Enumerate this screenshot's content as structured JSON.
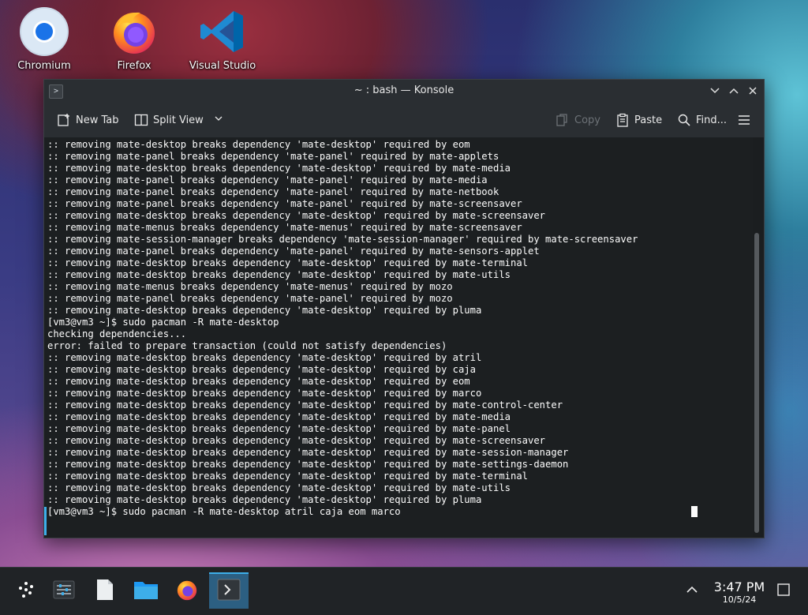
{
  "desktop": {
    "icons": [
      {
        "label": "Chromium",
        "icon": "chromium-icon"
      },
      {
        "label": "Firefox",
        "icon": "firefox-icon"
      },
      {
        "label": "Visual Studio",
        "icon": "vscode-icon"
      }
    ]
  },
  "window": {
    "title": "~ : bash — Konsole",
    "controls": {
      "minimize": "minimize-icon",
      "maximize": "maximize-icon",
      "close": "close-icon"
    }
  },
  "toolbar": {
    "new_tab": "New Tab",
    "split_view": "Split View",
    "copy": "Copy",
    "paste": "Paste",
    "find": "Find...",
    "menu": "hamburger-menu-icon"
  },
  "terminal": {
    "lines": [
      ":: removing mate-desktop breaks dependency 'mate-desktop' required by eom",
      ":: removing mate-panel breaks dependency 'mate-panel' required by mate-applets",
      ":: removing mate-desktop breaks dependency 'mate-desktop' required by mate-media",
      ":: removing mate-panel breaks dependency 'mate-panel' required by mate-media",
      ":: removing mate-panel breaks dependency 'mate-panel' required by mate-netbook",
      ":: removing mate-panel breaks dependency 'mate-panel' required by mate-screensaver",
      ":: removing mate-desktop breaks dependency 'mate-desktop' required by mate-screensaver",
      ":: removing mate-menus breaks dependency 'mate-menus' required by mate-screensaver",
      ":: removing mate-session-manager breaks dependency 'mate-session-manager' required by mate-screensaver",
      ":: removing mate-panel breaks dependency 'mate-panel' required by mate-sensors-applet",
      ":: removing mate-desktop breaks dependency 'mate-desktop' required by mate-terminal",
      ":: removing mate-desktop breaks dependency 'mate-desktop' required by mate-utils",
      ":: removing mate-menus breaks dependency 'mate-menus' required by mozo",
      ":: removing mate-panel breaks dependency 'mate-panel' required by mozo",
      ":: removing mate-desktop breaks dependency 'mate-desktop' required by pluma",
      "[vm3@vm3 ~]$ sudo pacman -R mate-desktop",
      "checking dependencies...",
      "error: failed to prepare transaction (could not satisfy dependencies)",
      ":: removing mate-desktop breaks dependency 'mate-desktop' required by atril",
      ":: removing mate-desktop breaks dependency 'mate-desktop' required by caja",
      ":: removing mate-desktop breaks dependency 'mate-desktop' required by eom",
      ":: removing mate-desktop breaks dependency 'mate-desktop' required by marco",
      ":: removing mate-desktop breaks dependency 'mate-desktop' required by mate-control-center",
      ":: removing mate-desktop breaks dependency 'mate-desktop' required by mate-media",
      ":: removing mate-desktop breaks dependency 'mate-desktop' required by mate-panel",
      ":: removing mate-desktop breaks dependency 'mate-desktop' required by mate-screensaver",
      ":: removing mate-desktop breaks dependency 'mate-desktop' required by mate-session-manager",
      ":: removing mate-desktop breaks dependency 'mate-desktop' required by mate-settings-daemon",
      ":: removing mate-desktop breaks dependency 'mate-desktop' required by mate-terminal",
      ":: removing mate-desktop breaks dependency 'mate-desktop' required by mate-utils",
      ":: removing mate-desktop breaks dependency 'mate-desktop' required by pluma",
      "[vm3@vm3 ~]$ sudo pacman -R mate-desktop atril caja eom marco"
    ]
  },
  "taskbar": {
    "items": [
      {
        "name": "application-launcher",
        "icon": "launcher-icon"
      },
      {
        "name": "system-settings",
        "icon": "settings-sliders-icon"
      },
      {
        "name": "text-document",
        "icon": "document-icon"
      },
      {
        "name": "files",
        "icon": "folder-icon"
      },
      {
        "name": "firefox",
        "icon": "firefox-icon"
      },
      {
        "name": "konsole",
        "icon": "terminal-icon",
        "active": true
      }
    ],
    "time": "3:47 PM",
    "date": "10/5/24",
    "tray": [
      "chevron-up-icon",
      "show-desktop-icon"
    ]
  },
  "colors": {
    "accent": "#3daee9",
    "terminal_bg": "#1c1f21",
    "terminal_fg": "#fcfcfc",
    "titlebar_bg": "#2a2e32",
    "taskbar_bg": "#202326"
  }
}
